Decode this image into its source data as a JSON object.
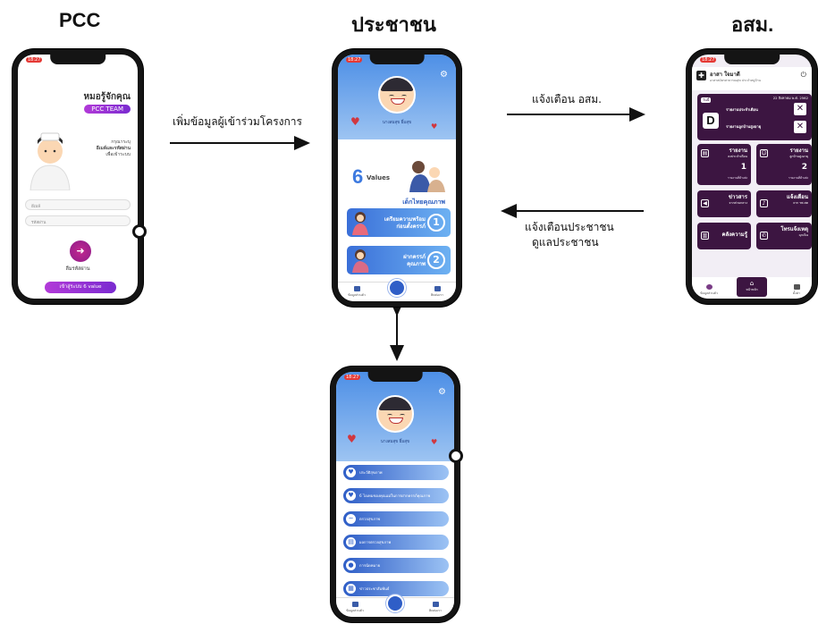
{
  "titles": {
    "pcc": "PCC",
    "citizen": "ประชาชน",
    "osm": "อสม."
  },
  "arrows": {
    "pcc_to_citizen": "เพิ่มข้อมูลผู้เข้าร่วมโครงการ",
    "citizen_to_osm": "แจ้งเตือน อสม.",
    "osm_to_citizen_line1": "แจ้งเตือนประชาชน",
    "osm_to_citizen_line2": "ดูแลประชาชน"
  },
  "status_time": "18:27",
  "pcc_phone": {
    "heading": "หมอรู้จักคุณ",
    "badge": "PCC TEAM",
    "desc_line1": "กรุณาระบุ",
    "desc_line2": "อีเมล์และรหัสผ่าน",
    "desc_line3": "เพื่อเข้าระบบ",
    "email_placeholder": "อีเมล์",
    "password_placeholder": "รหัสผ่าน",
    "forgot_label": "ลืมรหัสผ่าน",
    "login_button": "เข้าสู่ระบบ 6 value"
  },
  "citizen_phone": {
    "user_name": "นางสมสุข ยิ้มสุข",
    "values_number": "6",
    "values_word": "Values",
    "values_caption": "เด็กไทยคุณภาพ",
    "card1_label_line1": "เตรียมความพร้อม",
    "card1_label_line2": "ก่อนตั้งครรภ์",
    "card1_num": "1",
    "card2_label_line1": "ฝากครรภ์",
    "card2_label_line2": "คุณภาพ",
    "card2_num": "2",
    "tab_left": "ข้อมูลส่วนตัว",
    "tab_right": "ติดต่อเรา"
  },
  "citizen_menu_phone": {
    "user_name": "นางสมสุข ยิ้มสุข",
    "items": [
      "ประวัติสุขภาพ",
      "6 ไอเทมของคุณแม่ในการฝากครรภ์คุณภาพ",
      "ตรวจสุขภาพ",
      "ผลการตรวจสุขภาพ",
      "การนัดหมาย",
      "ข่าวประชาสัมพันธ์"
    ],
    "tab_left": "ข้อมูลส่วนตัว",
    "tab_right": "ติดต่อเรา"
  },
  "osm_phone": {
    "name": "อาสา ใจมาดี",
    "subtitle": "อาสาสมัครสาธารณสุข ประจำหมู่บ้าน",
    "chip": "วันนี้",
    "date": "22 สิงหาคม พ.ศ. 2562",
    "d_letter": "D",
    "line1": "รายงานประจำเดือน",
    "line2": "รายงานลูกบ้านสูงอายุ",
    "tiles": [
      {
        "label_line1": "รายงาน",
        "label_line2": "ลงประจำเดือน",
        "num": "1",
        "foot": "รายงานที่ค้างส่ง"
      },
      {
        "label_line1": "รายงาน",
        "label_line2": "ลูกบ้านสูงอายุ",
        "num": "2",
        "foot": "รายงานที่ค้างส่ง"
      },
      {
        "label_line1": "ข่าวสาร",
        "label_line2": "จากส่วนกลาง",
        "foot": ""
      },
      {
        "label_line1": "แจ้งเตือน",
        "label_line2": "จาก รพ.สต",
        "foot": ""
      },
      {
        "label_line1": "คลังความรู้",
        "label_line2": "",
        "foot": ""
      },
      {
        "label_line1": "โทรแจ้งเหตุ",
        "label_line2": "ฉุกเฉิน",
        "foot": ""
      }
    ],
    "tab_left": "ข้อมูลส่วนตัว",
    "tab_center": "หน้าหลัก",
    "tab_right": "ตั้งค่า"
  }
}
